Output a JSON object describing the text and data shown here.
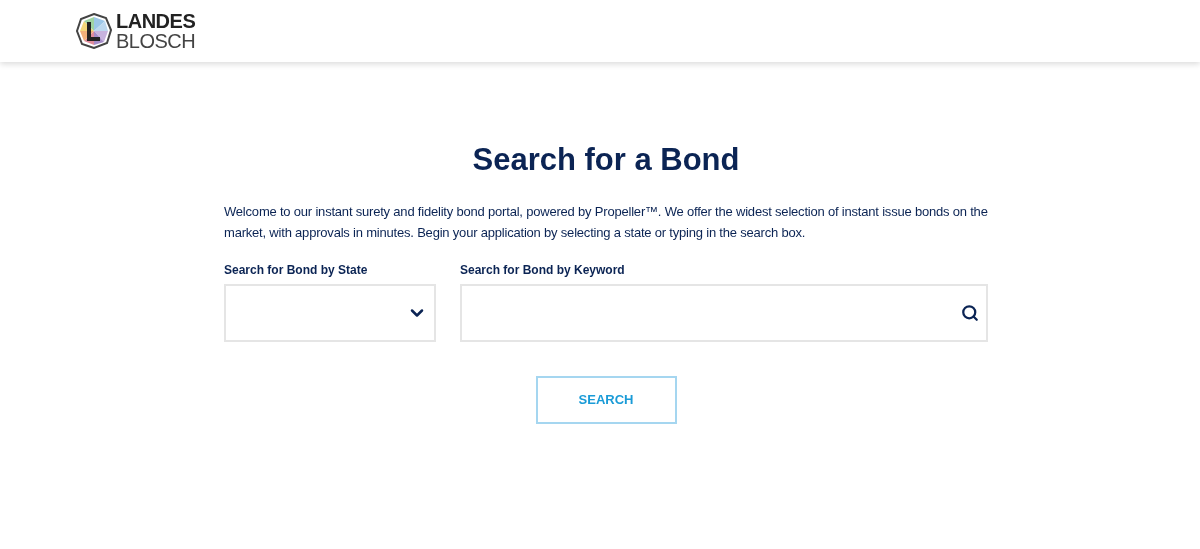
{
  "header": {
    "logo": {
      "line_1": "LANDES",
      "line_2": "BLOSCH"
    }
  },
  "title": "Search for a Bond",
  "intro": "Welcome to our instant surety and fidelity bond portal, powered by Propeller™. We offer the widest selection of instant issue bonds on the market, with approvals in minutes. Begin your application by selecting a state or typing in the search box.",
  "fields": [
    {
      "kind": "select",
      "label": "Search for Bond by State"
    },
    {
      "kind": "search",
      "label": "Search for Bond by Keyword"
    }
  ],
  "button": "SEARCH"
}
